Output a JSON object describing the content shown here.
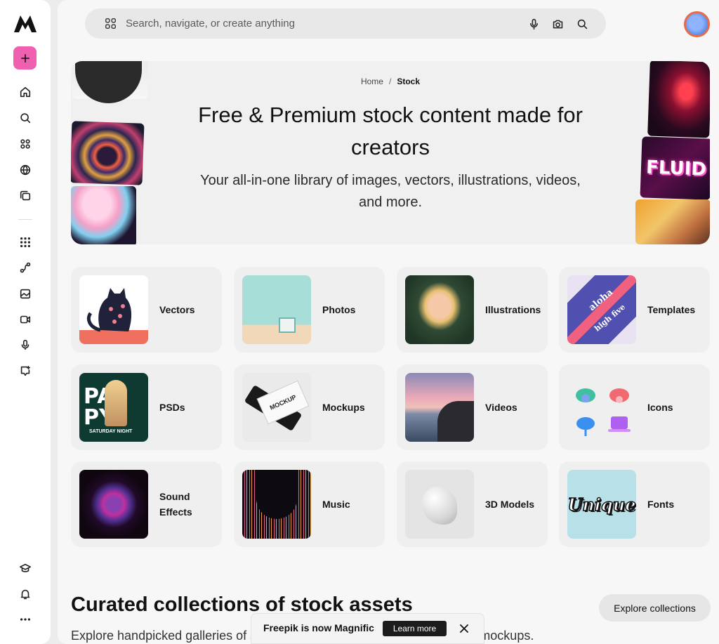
{
  "search": {
    "placeholder": "Search, navigate, or create anything"
  },
  "breadcrumb": {
    "home": "Home",
    "separator": "/",
    "current": "Stock"
  },
  "hero": {
    "title": "Free & Premium stock content made for creators",
    "subtitle": "Your all-in-one library of images, vectors, illustrations, videos, and more."
  },
  "categories": [
    {
      "label": "Vectors"
    },
    {
      "label": "Photos"
    },
    {
      "label": "Illustrations"
    },
    {
      "label": "Templates"
    },
    {
      "label": "PSDs"
    },
    {
      "label": "Mockups"
    },
    {
      "label": "Videos"
    },
    {
      "label": "Icons"
    },
    {
      "label": "Sound Effects"
    },
    {
      "label": "Music"
    },
    {
      "label": "3D Models"
    },
    {
      "label": "Fonts"
    }
  ],
  "thumbnail_text": {
    "fluid": "FLUID",
    "party_top": "PA",
    "party_bottom": "PY",
    "party_event": "SATURDAY NIGHT",
    "mockup": "MOCKUP",
    "font_sample": "Unique",
    "aloha": "aloha",
    "high_five": "high five"
  },
  "collections": {
    "title": "Curated collections of stock assets",
    "subtitle": "Explore handpicked galleries of stock assets, from photos and vectors to mockups.",
    "explore_label": "Explore collections"
  },
  "toast": {
    "message": "Freepik is now Magnific",
    "cta": "Learn more"
  },
  "colors": {
    "accent_pink": "#f060b0",
    "avatar_ring": "#e86a4a"
  },
  "icons": [
    "logo-icon",
    "plus-icon",
    "home-icon",
    "search-icon",
    "grid-icon",
    "globe-icon",
    "gallery-icon",
    "apps-icon",
    "workflow-icon",
    "image-ai-icon",
    "video-icon",
    "mic-icon",
    "chat-icon",
    "graduation-icon",
    "bell-icon",
    "more-icon",
    "camera-icon",
    "close-icon"
  ]
}
